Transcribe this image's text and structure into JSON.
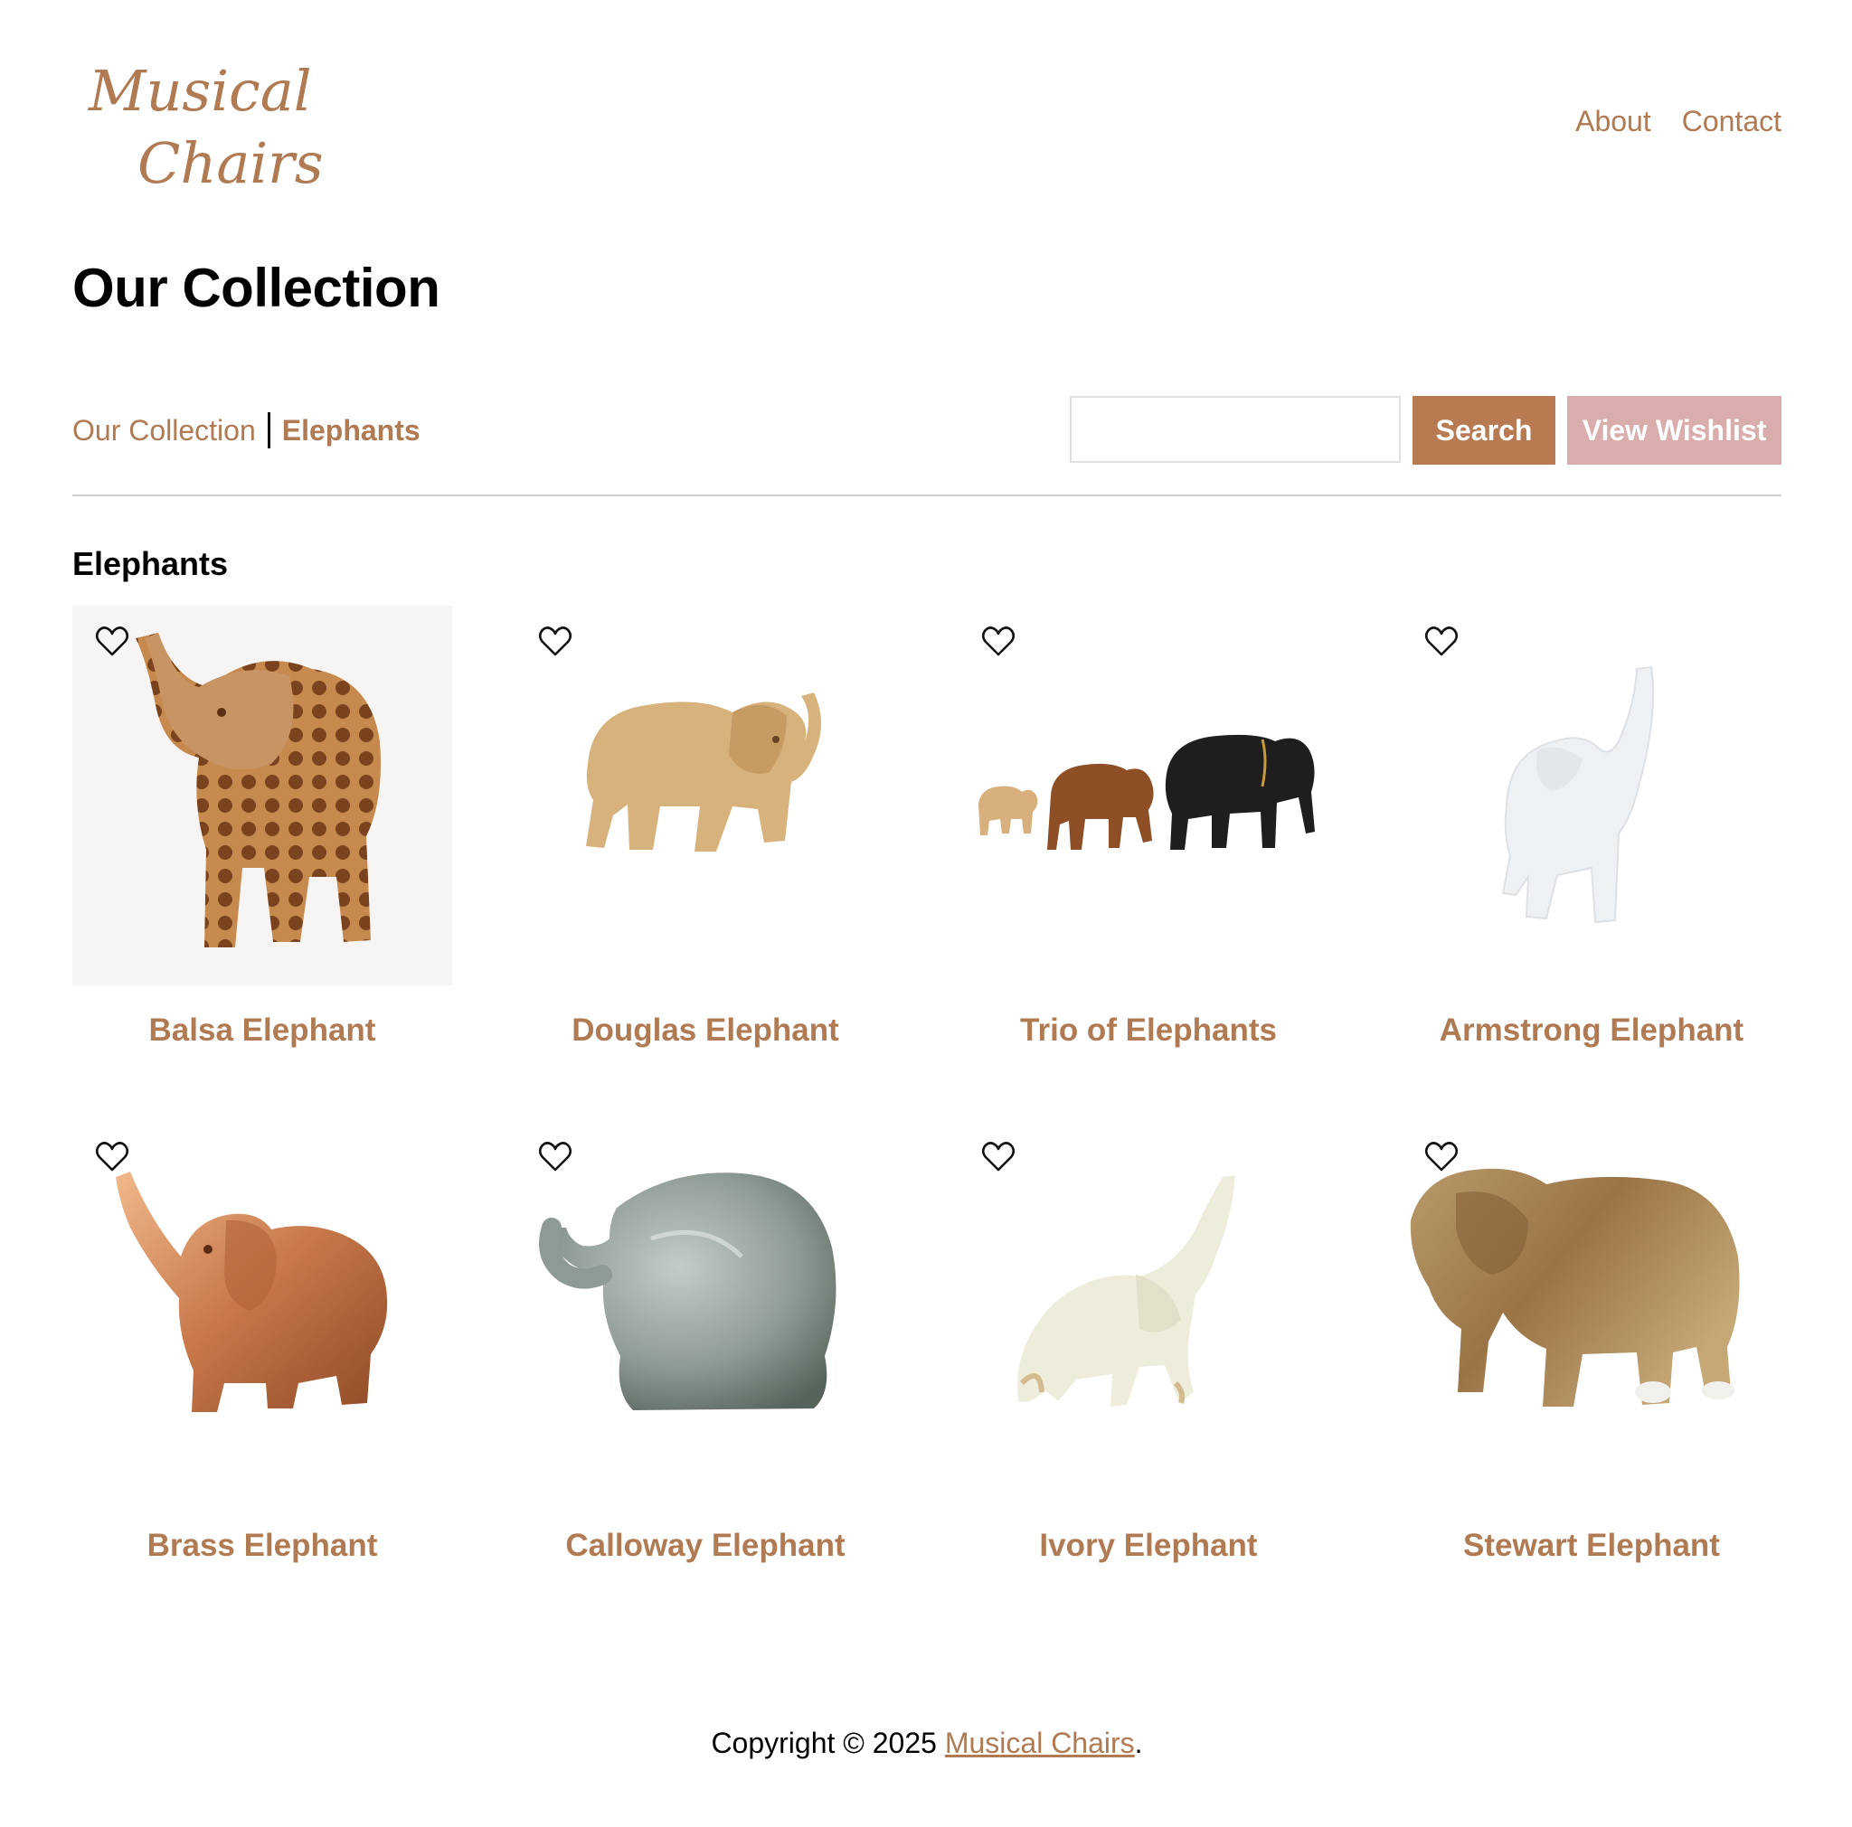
{
  "brand": {
    "logo_line1": "Musical",
    "logo_line2": "Chairs"
  },
  "nav": [
    {
      "label": "About"
    },
    {
      "label": "Contact"
    }
  ],
  "page_title": "Our Collection",
  "breadcrumb": {
    "parent": "Our Collection",
    "current": "Elephants"
  },
  "search": {
    "value": "",
    "button_label": "Search"
  },
  "wishlist_label": "View Wishlist",
  "section_title": "Elephants",
  "products": [
    {
      "name": "Balsa Elephant",
      "image": "carved-lattice-wood-elephant"
    },
    {
      "name": "Douglas Elephant",
      "image": "light-wood-elephant"
    },
    {
      "name": "Trio of Elephants",
      "image": "three-elephants-wood-and-black"
    },
    {
      "name": "Armstrong Elephant",
      "image": "white-ceramic-elephant"
    },
    {
      "name": "Brass Elephant",
      "image": "copper-elephant-trunk-up"
    },
    {
      "name": "Calloway Elephant",
      "image": "glass-elephant"
    },
    {
      "name": "Ivory Elephant",
      "image": "onyx-elephant-trunk-up"
    },
    {
      "name": "Stewart Elephant",
      "image": "glazed-brown-ceramic-elephant"
    }
  ],
  "footer": {
    "prefix": "Copyright © 2025 ",
    "link": "Musical Chairs",
    "suffix": "."
  },
  "colors": {
    "accent": "#b07a53",
    "search_button": "#b87a50",
    "wishlist_button": "#d8adac"
  }
}
